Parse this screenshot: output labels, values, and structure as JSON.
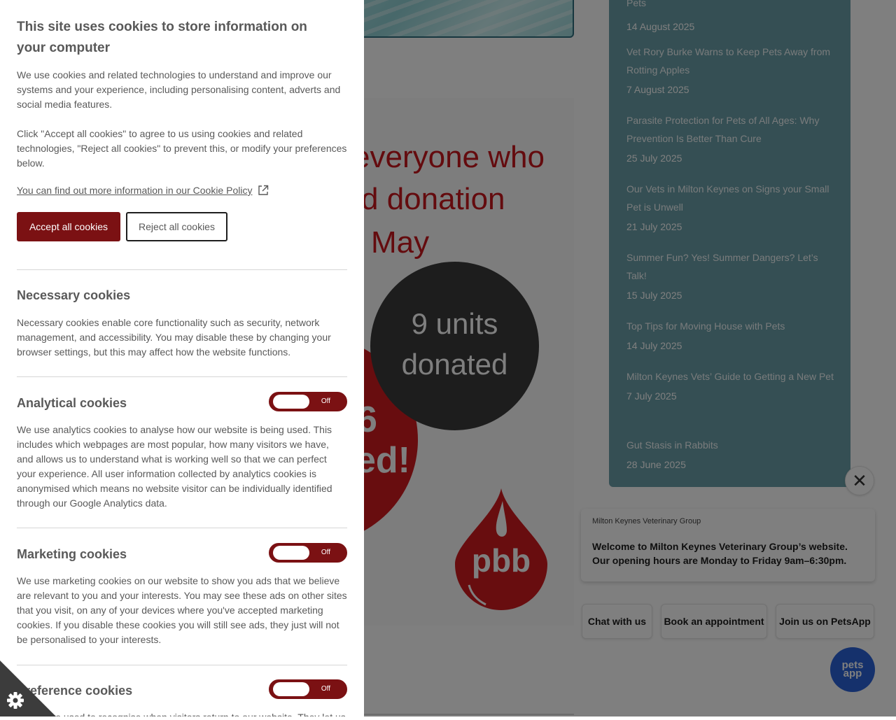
{
  "poster": {
    "line1": "everyone who",
    "line2": "d donation",
    "line3": "May",
    "circle_line1": "9 units",
    "circle_line2": "donated",
    "red_line1": "6",
    "red_line2": "ed!",
    "drop_text": "pbb"
  },
  "news": {
    "top_title": "Pets",
    "items": [
      {
        "title": "",
        "date": "14 August 2025"
      },
      {
        "title": "Vet Rory Burke Warns to Keep Pets Away from Rotting Apples",
        "date": "7 August 2025"
      },
      {
        "title": "Parasite Protection for Pets of All Ages: Why Prevention Is Better Than Cure",
        "date": "25 July 2025"
      },
      {
        "title": "Our Vets in Milton Keynes on Signs your Small Pet is Unwell",
        "date": "21 July 2025"
      },
      {
        "title": "Summer Fun? Yes! Summer Dangers? Let’s Talk!",
        "date": "15 July 2025"
      },
      {
        "title": "Top Tips for Moving House with Pets",
        "date": "14 July 2025"
      },
      {
        "title": "Milton Keynes Vets’ Guide to Getting a New Pet",
        "date": "7 July 2025"
      },
      {
        "title": "Gut Stasis in Rabbits",
        "date": "28 June 2025"
      }
    ]
  },
  "chat": {
    "close_glyph": "✕",
    "org": "Milton Keynes Veterinary Group",
    "message": "Welcome to Milton Keynes Veterinary Group’s website. Our opening hours are Monday to Friday 9am–6:30pm.",
    "btn_chat": "Chat with us",
    "btn_book": "Book an appointment",
    "btn_join": "Join us on PetsApp",
    "petsapp_line1": "pets",
    "petsapp_line2": "app",
    "petsapp_color": "#2a62d8"
  },
  "cookies": {
    "title": "This site uses cookies to store information on your computer",
    "intro1": "We use cookies and related technologies to understand and improve our systems and your experience, including personalising content, adverts and social media features.",
    "intro2": "Click \"Accept all cookies\" to agree to us using cookies and related technologies, \"Reject all cookies\" to prevent this, or modify your preferences below.",
    "policy_link": "You can find out more information in our Cookie Policy",
    "accept_label": "Accept all cookies",
    "reject_label": "Reject all cookies",
    "accent_color": "#7b1113",
    "necessary": {
      "heading": "Necessary cookies",
      "text": "Necessary cookies enable core functionality such as security, network management, and accessibility. You may disable these by changing your browser settings, but this may affect how the website functions."
    },
    "analytical": {
      "heading": "Analytical cookies",
      "toggle": "Off",
      "text": "We use analytics cookies to analyse how our website is being used. This includes which webpages are most popular, how many visitors we have, and allows us to understand what is working well so that we can perfect your experience. All user information collected by analytics cookies is anonymised which means no website visitor can be individually identified through our Google Analytics data."
    },
    "marketing": {
      "heading": "Marketing cookies",
      "toggle": "Off",
      "text": "We use marketing cookies on our website to show you ads that we believe are relevant to you and your interests. You may see these ads on other sites that you visit, on any of your devices where you've accepted marketing cookies. If you disable these cookies you will still see ads, they just will not be personalised to your interests."
    },
    "preference": {
      "heading": "Preference cookies",
      "toggle": "Off",
      "text": "These are used to recognise when visitors return to our website. They let us"
    }
  }
}
